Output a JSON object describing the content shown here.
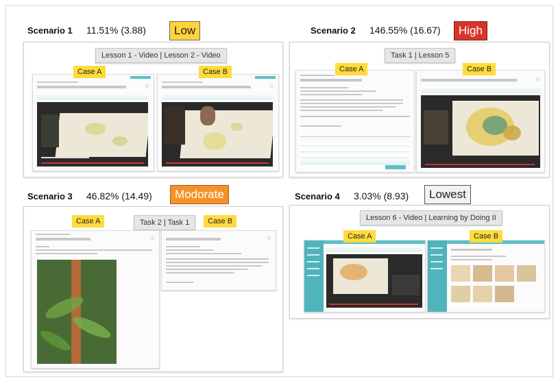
{
  "scenarios": [
    {
      "label": "Scenario 1",
      "percent": "11.51% (3.88)",
      "level": "Low",
      "lesson": "Lesson 1 - Video | Lesson 2 - Video",
      "case_a": "Case A",
      "case_b": "Case B"
    },
    {
      "label": "Scenario 2",
      "percent": "146.55% (16.67)",
      "level": "High",
      "lesson": "Task 1 | Lesson 5",
      "case_a": "Case A",
      "case_b": "Case B"
    },
    {
      "label": "Scenario 3",
      "percent": "46.82% (14.49)",
      "level": "Modorate",
      "lesson": "Task  2 | Task 1",
      "case_a": "Case A",
      "case_b": "Case B"
    },
    {
      "label": "Scenario 4",
      "percent": "3.03% (8.93)",
      "level": "Lowest",
      "lesson": "Lesson 6 - Video | Learning by Doing II",
      "case_a": "Case A",
      "case_b": "Case B"
    }
  ],
  "colors": {
    "low": "#ffd33a",
    "high": "#d9342b",
    "moderate": "#f4922a",
    "lowest": "#f2f2f2",
    "case": "#ffdb3c",
    "teal": "#5cc0c7"
  }
}
